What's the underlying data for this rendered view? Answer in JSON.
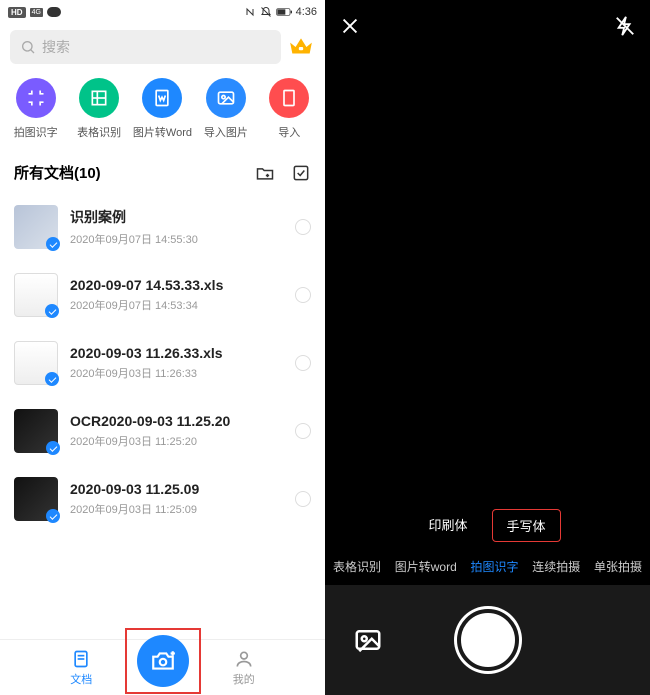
{
  "status": {
    "time": "4:36",
    "hd": "HD",
    "sig": "4G"
  },
  "search": {
    "placeholder": "搜索"
  },
  "tools": [
    {
      "label": "拍图识字",
      "colorClass": "c-purple"
    },
    {
      "label": "表格识别",
      "colorClass": "c-green"
    },
    {
      "label": "图片转Word",
      "colorClass": "c-blue"
    },
    {
      "label": "导入图片",
      "colorClass": "c-blue2"
    },
    {
      "label": "导入",
      "colorClass": "c-red"
    }
  ],
  "section": {
    "title": "所有文档(10)"
  },
  "docs": [
    {
      "title": "识别案例",
      "date": "2020年09月07日 14:55:30",
      "thumb": ""
    },
    {
      "title": "2020-09-07 14.53.33.xls",
      "date": "2020年09月07日 14:53:34",
      "thumb": "doc"
    },
    {
      "title": "2020-09-03 11.26.33.xls",
      "date": "2020年09月03日 11:26:33",
      "thumb": "doc"
    },
    {
      "title": "OCR2020-09-03 11.25.20",
      "date": "2020年09月03日 11:25:20",
      "thumb": "dark"
    },
    {
      "title": "2020-09-03 11.25.09",
      "date": "2020年09月03日 11:25:09",
      "thumb": "dark"
    }
  ],
  "bottomNav": {
    "docs": "文档",
    "mine": "我的"
  },
  "camera": {
    "pills": {
      "print": "印刷体",
      "hand": "手写体"
    },
    "tabs": [
      "表格识别",
      "图片转word",
      "拍图识字",
      "连续拍摄",
      "单张拍摄"
    ],
    "selectedTabIndex": 2
  }
}
